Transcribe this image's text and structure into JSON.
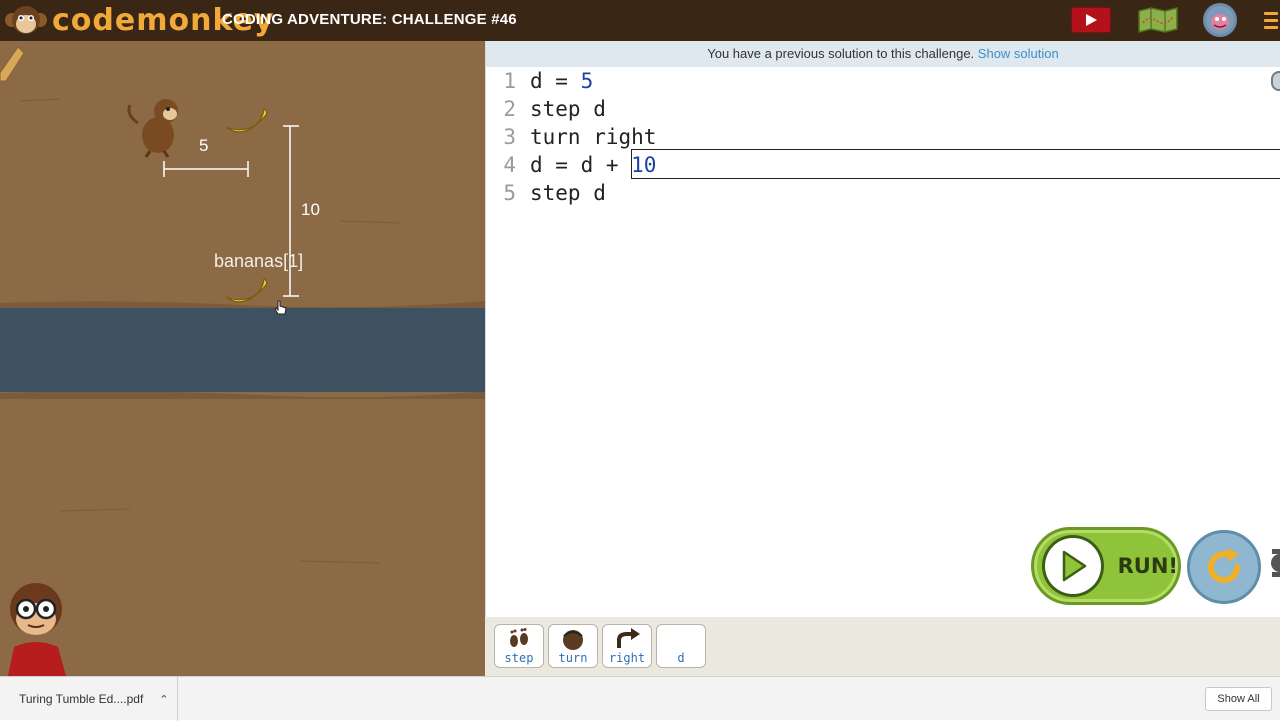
{
  "header": {
    "logo_text": "codemonkey",
    "challenge_title": "CODING ADVENTURE: CHALLENGE #46",
    "icons": [
      "video-icon",
      "map-icon",
      "avatar-icon",
      "menu-icon"
    ]
  },
  "game": {
    "distance_label_1": "5",
    "distance_label_2": "10",
    "object_label": "bananas[1]"
  },
  "editor": {
    "notice_text": "You have a previous solution to this challenge.",
    "notice_link": "Show solution",
    "lines": [
      {
        "num": "1",
        "text": "d = ",
        "value": "5"
      },
      {
        "num": "2",
        "text": "step d",
        "value": ""
      },
      {
        "num": "3",
        "text": "turn right",
        "value": ""
      },
      {
        "num": "4",
        "text": "d = d + ",
        "value": "10"
      },
      {
        "num": "5",
        "text": "step d",
        "value": ""
      }
    ]
  },
  "controls": {
    "run_label": "RUN!"
  },
  "palette": {
    "commands": [
      {
        "label": "step",
        "icon": "footprints-icon"
      },
      {
        "label": "turn",
        "icon": "monkey-head-icon"
      },
      {
        "label": "right",
        "icon": "turn-right-arrow-icon"
      },
      {
        "label": "d",
        "icon": ""
      }
    ]
  },
  "downloads": {
    "file_name": "Turing Tumble Ed....pdf",
    "show_all": "Show All"
  },
  "colors": {
    "topbar": "#3a2614",
    "brand_orange": "#f1a93a",
    "ground": "#8c6a46",
    "river": "#3e5160",
    "run_green": "#8fc33a",
    "reset_blue": "#8fb7cf",
    "number_blue": "#1d3fa5",
    "link_blue": "#3d8fc9"
  }
}
